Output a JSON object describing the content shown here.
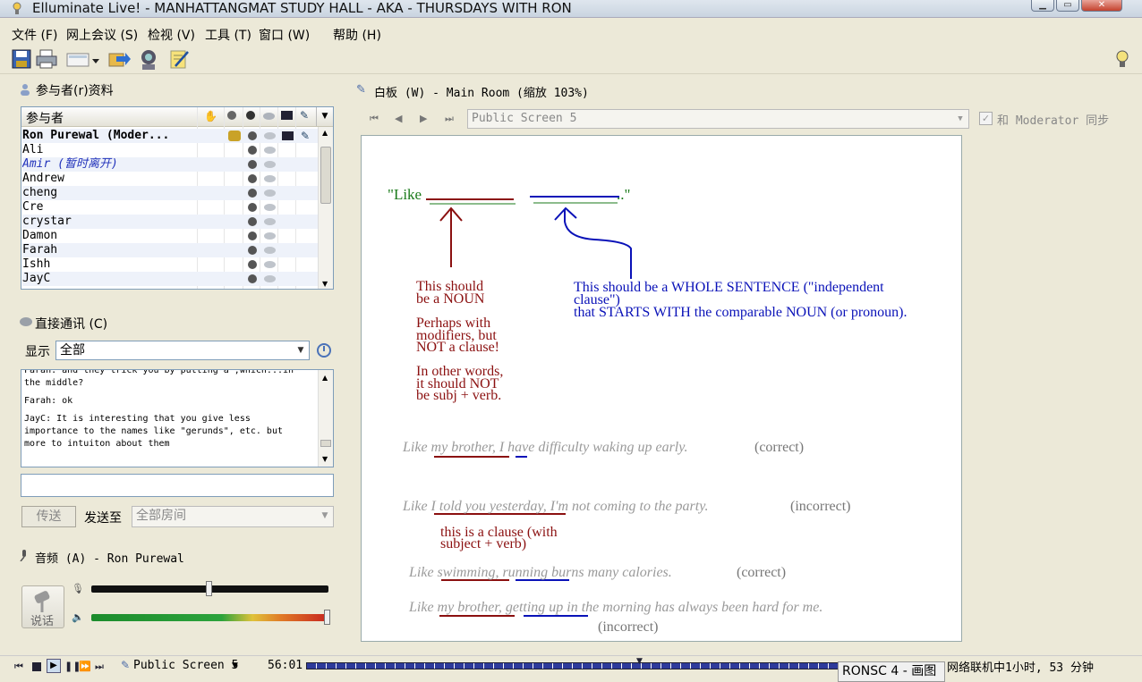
{
  "window": {
    "title": "Elluminate Live! - MANHATTANGMAT STUDY HALL - AKA - THURSDAYS WITH RON"
  },
  "menu": [
    "文件 (F)",
    "网上会议 (S)",
    "检视 (V)",
    "工具 (T)",
    "窗口 (W)",
    "帮助 (H)"
  ],
  "participants": {
    "header": "参与者(r)资料",
    "column": "参与者",
    "list": [
      {
        "name": "Ron Purewal (Moder...",
        "style": "bold"
      },
      {
        "name": "Ali",
        "style": "normal"
      },
      {
        "name": "Amir (暂时离开)",
        "style": "away"
      },
      {
        "name": "Andrew",
        "style": "normal"
      },
      {
        "name": "cheng",
        "style": "normal"
      },
      {
        "name": "Cre",
        "style": "normal"
      },
      {
        "name": "crystar",
        "style": "normal"
      },
      {
        "name": "Damon",
        "style": "normal"
      },
      {
        "name": "Farah",
        "style": "normal"
      },
      {
        "name": "Ishh",
        "style": "normal"
      },
      {
        "name": "JayC",
        "style": "normal"
      }
    ]
  },
  "chat": {
    "header": "直接通讯 (C)",
    "display_label": "显示",
    "display_value": "全部",
    "messages": [
      "Farah: and they trick you by putting a ,which...in the middle?",
      "Farah: ok",
      "JayC: It is interesting that you give less importance to the names like \"gerunds\", etc. but more to intuiton about them"
    ],
    "send_label": "传送",
    "send_to_label": "发送至",
    "send_to_value": "全部房间"
  },
  "audio": {
    "header": "音频 (A) - Ron Purewal",
    "talk_label": "说话",
    "mic_level": 0.5,
    "speaker_level": 1.0
  },
  "whiteboard": {
    "header": "白板 (W) - Main Room (缩放 103%)",
    "screen": "Public Screen 5",
    "sync_label": "和 Moderator 同步",
    "content": {
      "like_open": "\"Like",
      "like_close": "..\"",
      "noun_note": [
        "This should",
        "be a NOUN",
        "Perhaps with",
        "modifiers, but",
        "NOT a clause!",
        "In other words,",
        "it should NOT",
        "be subj + verb."
      ],
      "sentence_note": [
        "This should be a WHOLE SENTENCE (\"independent",
        "clause\")",
        "that STARTS WITH the comparable NOUN (or pronoun)."
      ],
      "ex1_pre": "Like ",
      "ex1_a": "my brother",
      "ex1_b": ", ",
      "ex1_c": "I",
      "ex1_d": " have difficulty waking up early.",
      "ex1_tag": "(correct)",
      "ex2_pre": "Like ",
      "ex2_a": "I told you yesterday",
      "ex2_d": ", I'm not coming to the party.",
      "ex2_tag": "(incorrect)",
      "clause_note": [
        "this is a clause (with",
        "subject + verb)"
      ],
      "ex3_pre": "Like ",
      "ex3_a": "swimming",
      "ex3_b": ", ",
      "ex3_c": "running",
      "ex3_d": " burns many calories.",
      "ex3_tag": "(correct)",
      "ex4_pre": "Like ",
      "ex4_a": "my brother",
      "ex4_b": ", ",
      "ex4_c": "getting up",
      "ex4_d": " in the morning has always been hard for me.",
      "ex4_tag": "(incorrect)"
    }
  },
  "statusbar": {
    "screen": "Public Screen 5",
    "time": "56:01",
    "online": "网络联机中1小时, 53 分钟",
    "task": "RONSC 4 - 画图"
  },
  "colors": {
    "red": "#8b1010",
    "blue": "#0a12b8",
    "green": "#1a7a1a"
  }
}
